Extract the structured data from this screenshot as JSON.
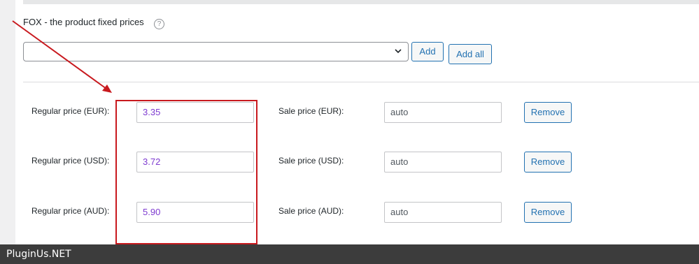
{
  "section": {
    "title": "FOX - the product fixed prices",
    "help_icon": "question-circle-icon"
  },
  "selector": {
    "value": "",
    "add_label": "Add",
    "add_all_label": "Add all"
  },
  "rows": [
    {
      "regular_label": "Regular price (EUR):",
      "regular_value": "3.35",
      "sale_label": "Sale price (EUR):",
      "sale_value": "auto",
      "remove_label": "Remove"
    },
    {
      "regular_label": "Regular price (USD):",
      "regular_value": "3.72",
      "sale_label": "Sale price (USD):",
      "sale_value": "auto",
      "remove_label": "Remove"
    },
    {
      "regular_label": "Regular price (AUD):",
      "regular_value": "5.90",
      "sale_label": "Sale price (AUD):",
      "sale_value": "auto",
      "remove_label": "Remove"
    }
  ],
  "footer": {
    "brand": "PluginUs.NET"
  },
  "colors": {
    "accent": "#2271b1",
    "annotation": "#c8191e",
    "price_text": "#7e3bd0",
    "footer_bg": "#3c3c3c"
  }
}
